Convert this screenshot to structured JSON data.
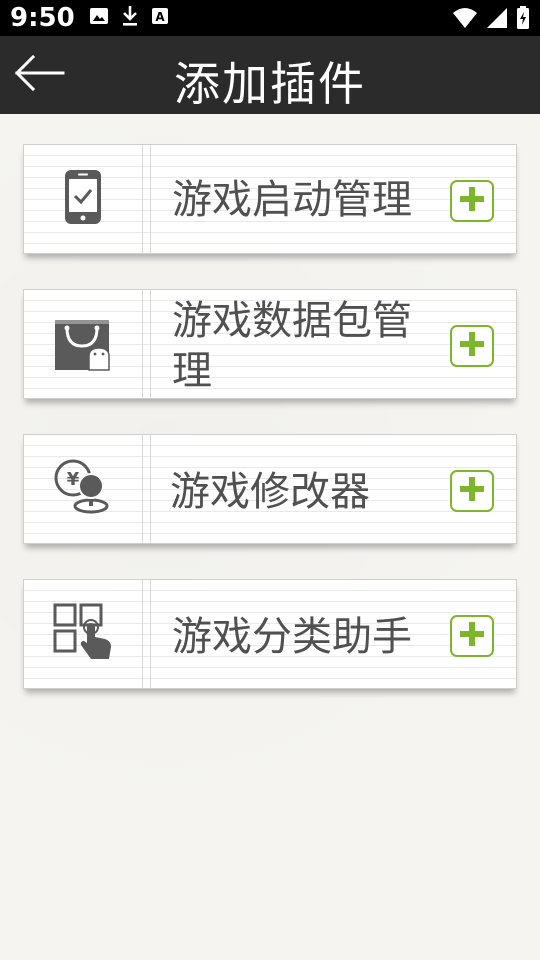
{
  "status_bar": {
    "time": "9:50",
    "left_icons": [
      "image-icon",
      "download-icon",
      "text-a-icon"
    ],
    "right_icons": [
      "wifi-icon",
      "cell-signal-icon",
      "battery-icon"
    ]
  },
  "app_bar": {
    "title": "添加插件",
    "back_icon": "arrow-left-icon"
  },
  "plugins": [
    {
      "name": "游戏启动管理",
      "icon": "phone-check-icon"
    },
    {
      "name": "游戏数据包管理",
      "icon": "shopping-bag-android-icon"
    },
    {
      "name": "游戏修改器",
      "icon": "coin-joystick-icon"
    },
    {
      "name": "游戏分类助手",
      "icon": "grid-hand-icon"
    }
  ],
  "colors": {
    "status_bar": "#000000",
    "app_bar": "#2b2b2b",
    "accent_green": "#7fb52a",
    "icon_gray": "#5a5a5a",
    "text_gray": "#505050"
  }
}
